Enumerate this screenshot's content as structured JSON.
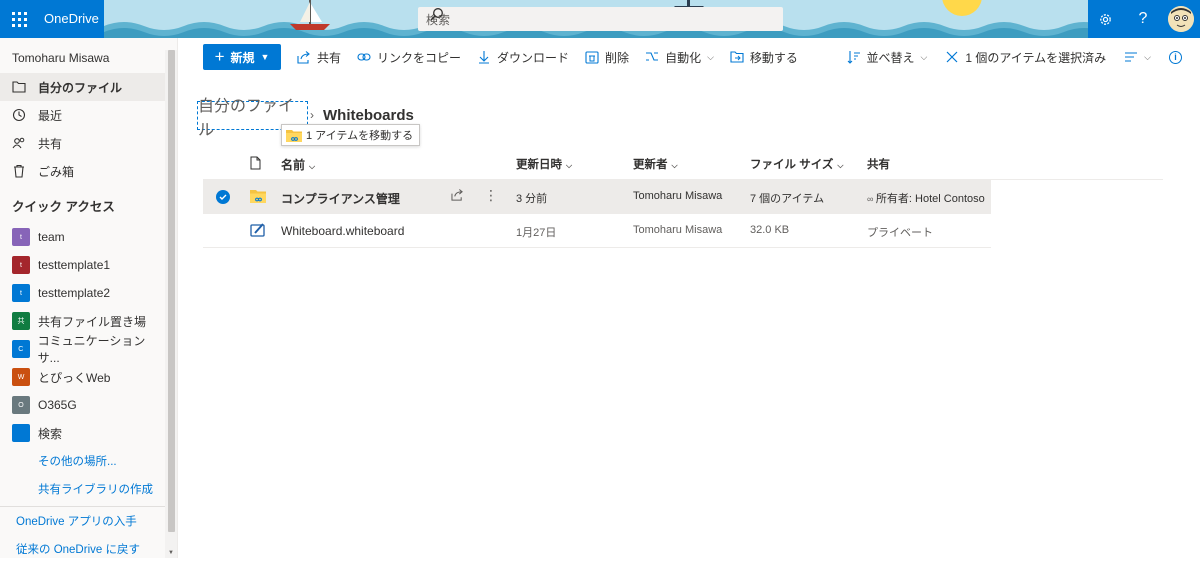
{
  "suite": {
    "app_name": "OneDrive",
    "search_placeholder": "検索",
    "settings_icon": "gear-icon",
    "help_label": "?"
  },
  "nav": {
    "user_name": "Tomoharu Misawa",
    "items": [
      {
        "label": "自分のファイル",
        "icon": "folder-icon",
        "active": true
      },
      {
        "label": "最近",
        "icon": "clock-icon"
      },
      {
        "label": "共有",
        "icon": "people-icon"
      },
      {
        "label": "ごみ箱",
        "icon": "trash-icon"
      }
    ],
    "quick_access_title": "クイック アクセス",
    "quick_access": [
      {
        "label": "team",
        "letter": "t",
        "color": "#8764b8"
      },
      {
        "label": "testtemplate1",
        "letter": "t",
        "color": "#a4262c"
      },
      {
        "label": "testtemplate2",
        "letter": "t",
        "color": "#0078d4"
      },
      {
        "label": "共有ファイル置き場",
        "letter": "共",
        "color": "#107c41"
      },
      {
        "label": "コミュニケーションサ...",
        "letter": "C",
        "color": "#0078d4"
      },
      {
        "label": "とぴっくWeb",
        "letter": "W",
        "color": "#ca5010"
      },
      {
        "label": "O365G",
        "letter": "O",
        "color": "#69797e"
      },
      {
        "label": "検索",
        "letter": "",
        "color": "#0078d4"
      }
    ],
    "other_places": "その他の場所...",
    "create_library": "共有ライブラリの作成",
    "get_apps": "OneDrive アプリの入手",
    "classic": "従来の OneDrive に戻す"
  },
  "commands": {
    "new": "新規",
    "share": "共有",
    "copy_link": "リンクをコピー",
    "download": "ダウンロード",
    "delete": "削除",
    "automate": "自動化",
    "move": "移動する",
    "sort": "並べ替え",
    "selected": "1 個のアイテムを選択済み",
    "info_label": "i"
  },
  "breadcrumb": {
    "root": "自分のファイル",
    "separator": "›",
    "current": "Whiteboards",
    "move_tooltip": "1 アイテムを移動する"
  },
  "columns": {
    "name": "名前",
    "modified": "更新日時",
    "modified_by": "更新者",
    "size": "ファイル サイズ",
    "sharing": "共有"
  },
  "rows": [
    {
      "name": "コンプライアンス管理",
      "type": "folder",
      "modified": "3 分前",
      "modified_by": "Tomoharu Misawa",
      "size": "7 個のアイテム",
      "sharing": "所有者: Hotel Contoso",
      "selected": true
    },
    {
      "name": "Whiteboard.whiteboard",
      "type": "whiteboard",
      "modified": "1月27日",
      "modified_by": "Tomoharu Misawa",
      "size": "32.0 KB",
      "sharing": "プライベート",
      "selected": false
    }
  ]
}
